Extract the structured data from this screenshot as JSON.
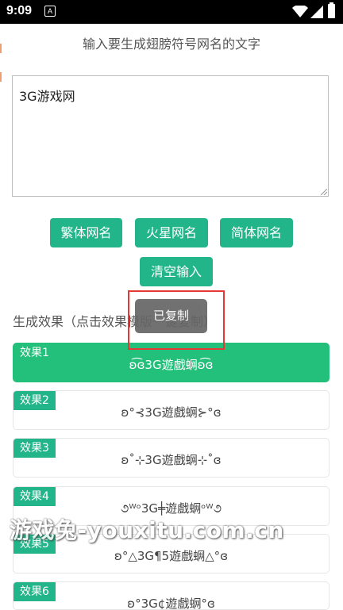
{
  "status_bar": {
    "time": "9:09"
  },
  "prompt": "输入要生成翅膀符号网名的文字",
  "input": {
    "value": "3G游戏网"
  },
  "buttons": {
    "traditional": "繁体网名",
    "martian": "火星网名",
    "simplified": "简体网名",
    "clear": "清空输入"
  },
  "section_title": "生成效果（点击效果模版一键复制）",
  "effects": [
    {
      "label": "效果1",
      "name": "ʚ͡ɞ3G遊戲蛧ʚ͡ɞ"
    },
    {
      "label": "效果2",
      "name": "ʚ°⊰3G遊戲蛧⊱°ɞ"
    },
    {
      "label": "效果3",
      "name": "ʚ˚⊹3G遊戲蛧⊹˚ɞ"
    },
    {
      "label": "效果4",
      "name": "૭ᵂᵒ3G╪遊戲蛧ᵒᵂ૭"
    },
    {
      "label": "效果5",
      "name": "ʚ°△3G¶5遊戲蛧△°ɞ"
    },
    {
      "label": "效果6",
      "name": "ʚ°3G¢遊戲蛧°ɞ"
    }
  ],
  "toast": "已复制",
  "watermark": "游戏兔-youxitu.com.cn",
  "colors": {
    "accent": "#22b58a",
    "active_bg": "#22c07a",
    "highlight": "#e53935"
  }
}
